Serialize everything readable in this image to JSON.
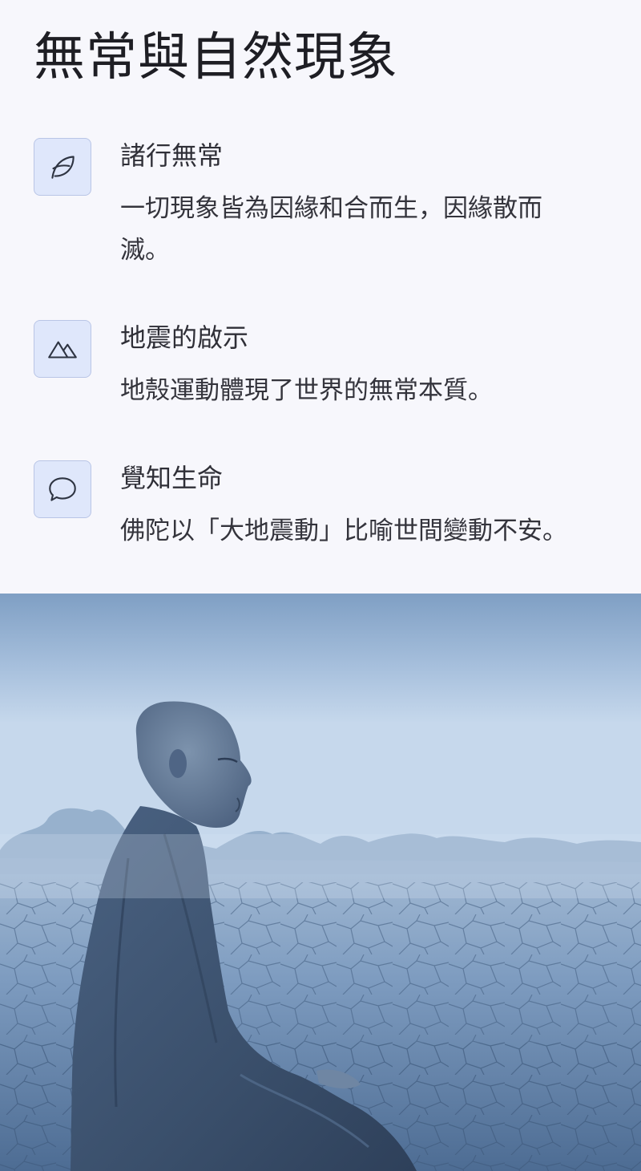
{
  "page": {
    "title": "無常與自然現象"
  },
  "items": [
    {
      "icon": "leaf-icon",
      "title": "諸行無常",
      "description": "一切現象皆為因緣和合而生，因緣散而滅。"
    },
    {
      "icon": "mountain-icon",
      "title": "地震的啟示",
      "description": "地殼運動體現了世界的無常本質。"
    },
    {
      "icon": "speech-bubble-icon",
      "title": "覺知生命",
      "description": "佛陀以「大地震動」比喻世間變動不安。"
    }
  ],
  "photo": {
    "subject": "monk-meditating-on-cracked-earth-image"
  },
  "colors": {
    "background": "#f7f7fc",
    "icon_box_fill": "#dfe7fb",
    "icon_box_border": "#b9c5e6",
    "icon_stroke": "#2e3442",
    "photo_tint": "#6f8fb3"
  }
}
